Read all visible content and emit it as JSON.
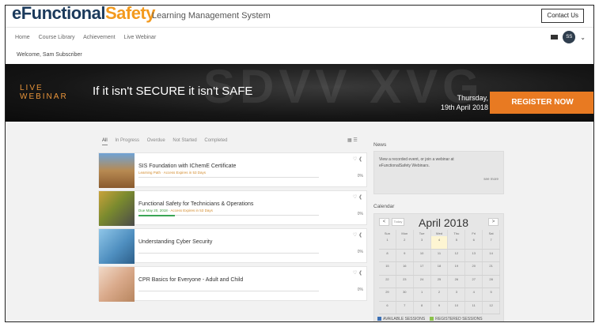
{
  "header": {
    "logo_part1": "eFunctional",
    "logo_part2": "Safety",
    "subtitle": "Learning Management System",
    "contact_label": "Contact Us"
  },
  "nav": {
    "items": [
      "Home",
      "Course Library",
      "Achievement",
      "Live Webinar"
    ],
    "avatar_initials": "SS"
  },
  "welcome": "Welcome, Sam Subscriber",
  "banner": {
    "live_line1": "LIVE",
    "live_line2": "WEBINAR",
    "title": "If it isn't SECURE it isn't SAFE",
    "date_line1": "Thursday,",
    "date_line2": "19th April 2018",
    "register_label": "REGISTER NOW"
  },
  "filters": [
    "All",
    "In Progress",
    "Overdue",
    "Not Started",
    "Completed"
  ],
  "courses": [
    {
      "title": "SIS Foundation with IChemE Certificate",
      "meta_green": "",
      "meta": "Learning Path · Access Expires in 53 Days",
      "progress": 0,
      "percent": "0%"
    },
    {
      "title": "Functional Safety for Technicians & Operations",
      "meta_green": "Due May 20, 2018 ·",
      "meta": "Access Expires in 53 Days",
      "progress": 20,
      "percent": "0%"
    },
    {
      "title": "Understanding Cyber Security",
      "meta_green": "",
      "meta": "",
      "progress": 0,
      "percent": "0%"
    },
    {
      "title": "CPR Basics for Everyone - Adult and Child",
      "meta_green": "",
      "meta": "",
      "progress": 0,
      "percent": "0%"
    }
  ],
  "news": {
    "heading": "News",
    "text": "View a recorded event, or join a webinar at eFunctionalSafety Webinars.",
    "see_more": "see more"
  },
  "calendar": {
    "heading": "Calendar",
    "prev": "<",
    "today": "Today",
    "next": ">",
    "month": "April 2018",
    "day_headers": [
      "Sun",
      "Mon",
      "Tue",
      "Wed",
      "Thu",
      "Fri",
      "Sat"
    ],
    "weeks": [
      [
        "1",
        "2",
        "3",
        "4",
        "5",
        "6",
        "7"
      ],
      [
        "8",
        "9",
        "10",
        "11",
        "12",
        "13",
        "14"
      ],
      [
        "15",
        "16",
        "17",
        "18",
        "19",
        "20",
        "21"
      ],
      [
        "22",
        "23",
        "24",
        "25",
        "26",
        "27",
        "28"
      ],
      [
        "29",
        "30",
        "1",
        "2",
        "3",
        "4",
        "5"
      ],
      [
        "6",
        "7",
        "8",
        "9",
        "10",
        "11",
        "12"
      ]
    ],
    "legend_available": "AVAILABLE SESSIONS",
    "legend_registered": "REGISTERED SESSIONS"
  },
  "colors": {
    "accent_orange": "#e87a22",
    "logo_blue": "#1b3a5c",
    "progress_green": "#3aa655"
  }
}
